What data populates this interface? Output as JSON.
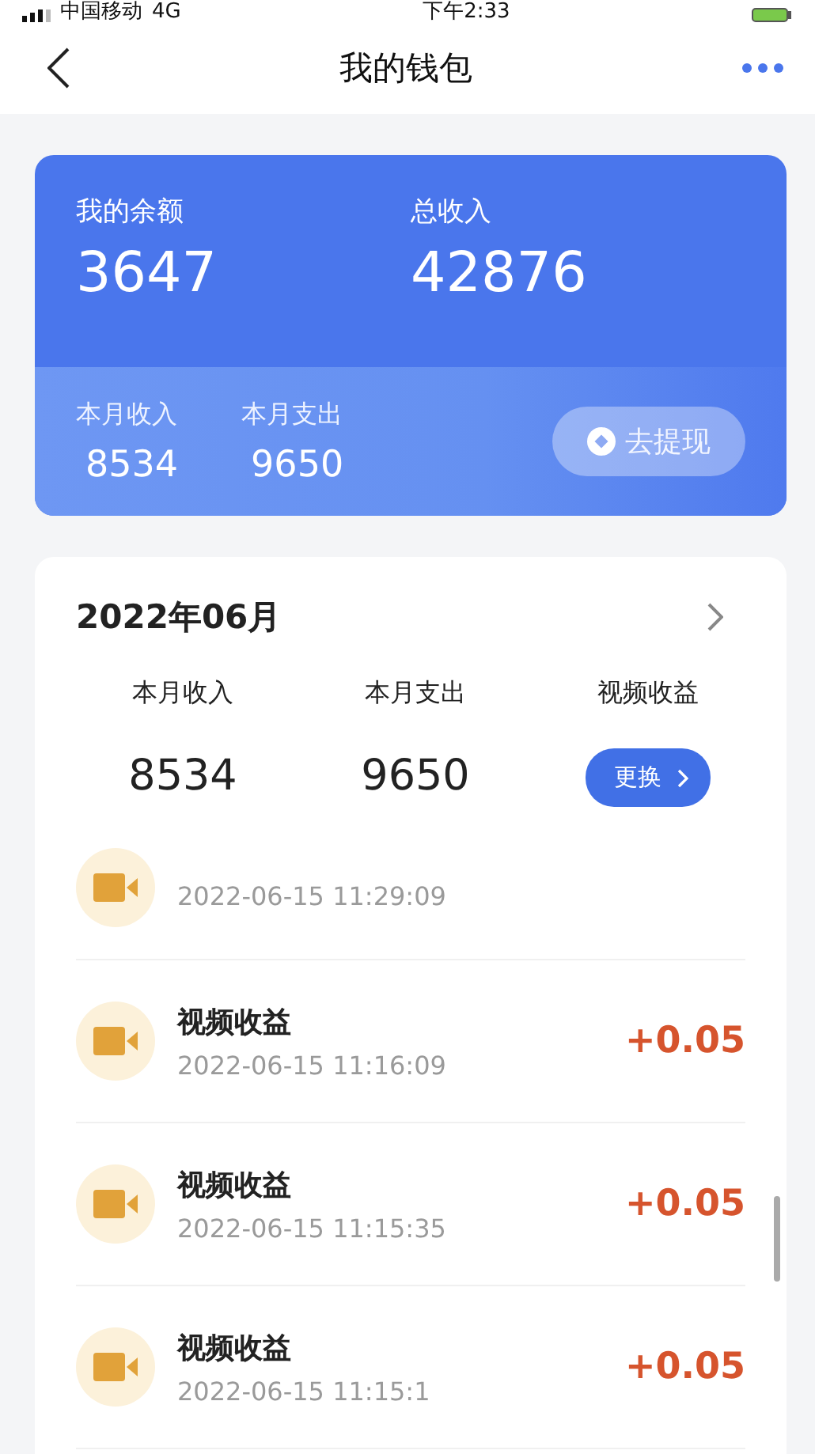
{
  "status_bar": {
    "carrier": "中国移动",
    "network": "4G",
    "time": "下午2:33"
  },
  "nav": {
    "title": "我的钱包"
  },
  "balance_card": {
    "balance_label": "我的余额",
    "balance": "3647",
    "total_label": "总收入",
    "total": "42876",
    "month_income_label": "本月收入",
    "month_income": "8534",
    "month_expense_label": "本月支出",
    "month_expense": "9650",
    "withdraw_button": "去提现"
  },
  "month_panel": {
    "month": "2022年06月",
    "income_label": "本月收入",
    "income": "8534",
    "expense_label": "本月支出",
    "expense": "9650",
    "type_label": "视频收益",
    "switch_button": "更换"
  },
  "records": [
    {
      "kind": "partial",
      "time": "2022-06-15 11:29:09"
    },
    {
      "kind": "full",
      "title": "视频收益",
      "time": "2022-06-15 11:16:09",
      "amount": "+0.05"
    },
    {
      "kind": "full",
      "title": "视频收益",
      "time": "2022-06-15 11:15:35",
      "amount": "+0.05"
    },
    {
      "kind": "full",
      "title": "视频收益",
      "time": "2022-06-15 11:15:1",
      "amount": "+0.05"
    }
  ]
}
